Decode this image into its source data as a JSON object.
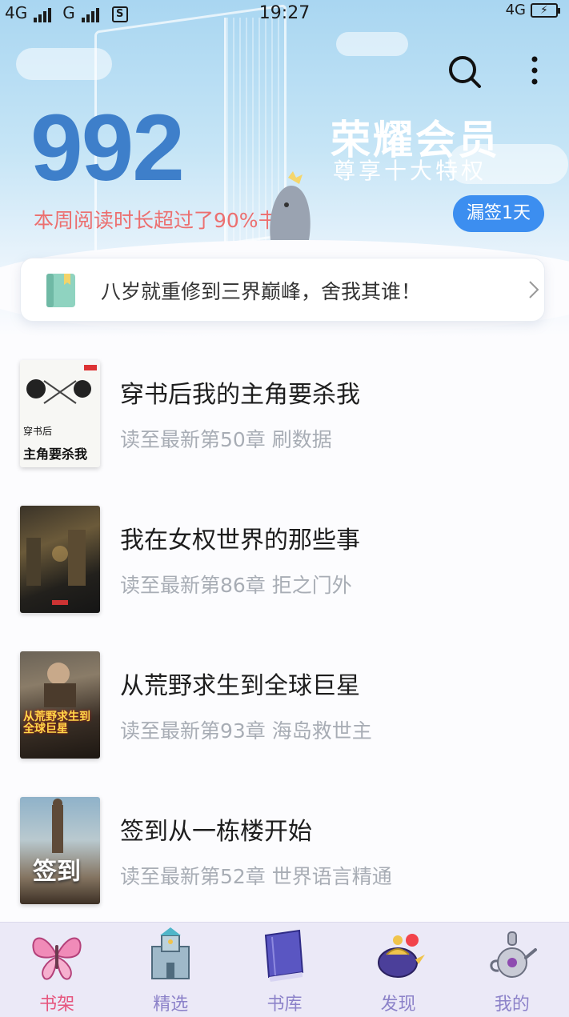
{
  "status_bar": {
    "net1": "4G",
    "net2": "G",
    "time": "19:27",
    "net_right": "4G",
    "sim_label": "S"
  },
  "header": {
    "reading_minutes": "992",
    "reading_caption": "本周阅读时长超过了90%书友",
    "vip_title": "荣耀会员",
    "vip_subtitle": "尊享十大特权",
    "sign_button": "漏签1天"
  },
  "notice": {
    "text": "八岁就重修到三界巅峰，舍我其谁！"
  },
  "books": [
    {
      "title": "穿书后我的主角要杀我",
      "progress": "读至最新第50章 刷数据",
      "cover_small": "穿书后",
      "cover_big": "主角要杀我"
    },
    {
      "title": "我在女权世界的那些事",
      "progress": "读至最新第86章 拒之门外"
    },
    {
      "title": "从荒野求生到全球巨星",
      "progress": "读至最新第93章 海岛救世主",
      "cover_big": "从荒野求生到全球巨星"
    },
    {
      "title": "签到从一栋楼开始",
      "progress": "读至最新第52章 世界语言精通",
      "cover_big": "签到"
    }
  ],
  "nav": [
    {
      "label": "书架",
      "icon": "butterfly-icon",
      "active": true
    },
    {
      "label": "精选",
      "icon": "castle-icon",
      "active": false
    },
    {
      "label": "书库",
      "icon": "book-stack-icon",
      "active": false
    },
    {
      "label": "发现",
      "icon": "magic-lamp-icon",
      "active": false
    },
    {
      "label": "我的",
      "icon": "teapot-icon",
      "active": false
    }
  ],
  "colors": {
    "accent_blue": "#3e7fca",
    "button_blue": "#3c8ef0",
    "caption_red": "#ec6f6f",
    "nav_active": "#e6567e",
    "nav_inactive": "#8c82c9"
  }
}
